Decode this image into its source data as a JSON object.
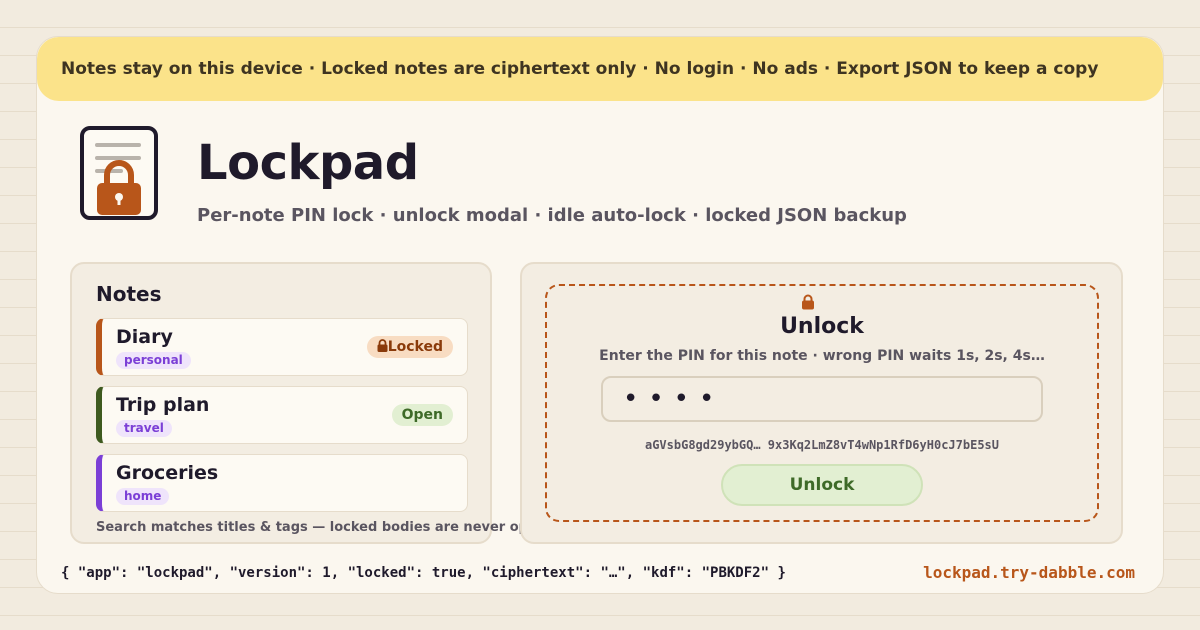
{
  "banner": {
    "text": "Notes stay on this device · Locked notes are ciphertext only · No login · No ads · Export JSON to keep a copy"
  },
  "app": {
    "icon": "lockpad-logo-icon",
    "title": "Lockpad",
    "subtitle": "Per-note PIN lock · unlock modal · idle auto-lock · locked JSON backup"
  },
  "notes": {
    "heading": "Notes",
    "items": [
      {
        "title": "Diary",
        "tag": "personal",
        "status": "Locked",
        "accent": "#b8561a"
      },
      {
        "title": "Trip plan",
        "tag": "travel",
        "status": "Open",
        "accent": "#3e5a1f"
      },
      {
        "title": "Groceries",
        "tag": "home",
        "status": "",
        "accent": "#7b3fd6"
      }
    ],
    "search_hint": "Search matches titles & tags — locked bodies are never opened"
  },
  "unlock_modal": {
    "icon": "lock-icon",
    "title": "Unlock",
    "description": "Enter the PIN for this note · wrong PIN waits 1s, 2s, 4s…",
    "pin_value": "••••",
    "ciphertext_preview": "aGVsbG8gd29ybGQ… 9x3Kq2LmZ8vT4wNp1RfD6yH0cJ7bE5sU",
    "button_label": "Unlock"
  },
  "footer": {
    "json_example": "{ \"app\": \"lockpad\", \"version\": 1, \"locked\": true, \"ciphertext\": \"…\", \"kdf\": \"PBKDF2\" }",
    "site": "lockpad.try-dabble.com"
  },
  "colors": {
    "banner": "#fbe38a",
    "accent": "#b8561a",
    "open_green": "#3e6a28",
    "tag_purple": "#7b3fd6"
  }
}
